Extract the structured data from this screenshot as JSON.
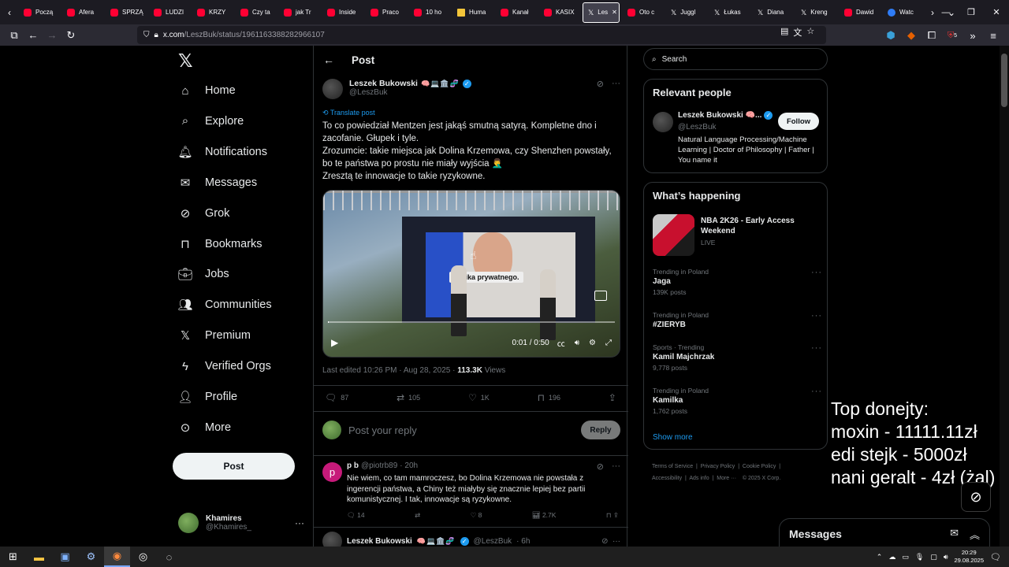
{
  "browser": {
    "tabs": [
      {
        "label": "Począ",
        "icon": "youtube-icon"
      },
      {
        "label": "Afera",
        "icon": "youtube-icon"
      },
      {
        "label": "SPRZĄ",
        "icon": "youtube-icon"
      },
      {
        "label": "LUDZI",
        "icon": "youtube-icon"
      },
      {
        "label": "KRZY",
        "icon": "youtube-icon"
      },
      {
        "label": "Czy ta",
        "icon": "youtube-icon"
      },
      {
        "label": "jak Tr",
        "icon": "youtube-icon"
      },
      {
        "label": "Inside",
        "icon": "youtube-icon"
      },
      {
        "label": "Praco",
        "icon": "youtube-icon"
      },
      {
        "label": "10 ho",
        "icon": "youtube-icon"
      },
      {
        "label": "Huma",
        "icon": "bookmark-icon"
      },
      {
        "label": "Kanał",
        "icon": "youtube-icon"
      },
      {
        "label": "KASIX",
        "icon": "youtube-icon"
      },
      {
        "label": "Les",
        "icon": "x-icon",
        "active": true
      },
      {
        "label": "Oto c",
        "icon": "youtube-icon"
      },
      {
        "label": "Juggl",
        "icon": "x-icon"
      },
      {
        "label": "Łukas",
        "icon": "x-icon"
      },
      {
        "label": "Diana",
        "icon": "x-icon"
      },
      {
        "label": "Kreng",
        "icon": "x-icon"
      },
      {
        "label": "Dawid",
        "icon": "youtube-icon"
      },
      {
        "label": "Watc",
        "icon": "copilot-icon"
      }
    ],
    "url_host": "x.com",
    "url_path": "/LeszBuk/status/1961163388282966107",
    "ext_badge": "5"
  },
  "nav": {
    "items": [
      {
        "label": "Home",
        "icon": "home-icon"
      },
      {
        "label": "Explore",
        "icon": "search-icon"
      },
      {
        "label": "Notifications",
        "icon": "bell-icon"
      },
      {
        "label": "Messages",
        "icon": "mail-icon"
      },
      {
        "label": "Grok",
        "icon": "grok-icon"
      },
      {
        "label": "Bookmarks",
        "icon": "bookmark-icon"
      },
      {
        "label": "Jobs",
        "icon": "briefcase-icon"
      },
      {
        "label": "Communities",
        "icon": "people-icon"
      },
      {
        "label": "Premium",
        "icon": "x-logo-icon"
      },
      {
        "label": "Verified Orgs",
        "icon": "lightning-icon"
      },
      {
        "label": "Profile",
        "icon": "person-icon"
      },
      {
        "label": "More",
        "icon": "more-circle-icon"
      }
    ],
    "post_button": "Post",
    "user": {
      "name": "Khamires",
      "handle": "@Khamires_"
    }
  },
  "main": {
    "header_title": "Post",
    "tweet": {
      "author": "Leszek Bukowski",
      "emoji": "🧠💻🏛️🧬",
      "handle": "@LeszBuk",
      "translate": "Translate post",
      "text_lines": [
        "To co powiedział Mentzen jest jakąś smutną satyrą. Kompletne dno i zacofanie. Głupek i tyle.",
        "Zrozumcie: takie miejsca jak Dolina Krzemowa, czy Shenzhen powstały, bo te państwa po prostu nie miały wyjścia 🤦‍♂️",
        "Zresztą te innowacje to takie ryzykowne."
      ],
      "video": {
        "caption": "yanika prywatnego.",
        "time": "0:01 / 0:50"
      },
      "meta_edited": "Last edited 10:26 PM · Aug 28, 2025 · ",
      "meta_views_count": "113.3K",
      "meta_views_label": " Views",
      "actions": {
        "replies": "87",
        "reposts": "105",
        "likes": "1K",
        "bookmarks": "196"
      }
    },
    "reply_placeholder": "Post your reply",
    "reply_button": "Reply",
    "reply": {
      "name": "p b",
      "avatar_letter": "p",
      "handle": "@piotrb89",
      "time": "· 20h",
      "text": "Nie wiem, co tam mamroczesz, bo Dolina Krzemowa nie powstała z ingerencji państwa, a Chiny też miałyby się znacznie lepiej bez partii komunistycznej. I tak, innowacje są ryzykowne.",
      "actions": {
        "replies": "14",
        "reposts": "",
        "likes": "8",
        "views": "2.7K"
      }
    },
    "next_reply": {
      "name": "Leszek Bukowski",
      "emoji": "🧠💻🏛️🧬",
      "handle": "@LeszBuk",
      "time": "· 6h"
    }
  },
  "sidebar": {
    "search_placeholder": "Search",
    "relevant_title": "Relevant people",
    "person": {
      "name": "Leszek Bukowski 🧠...",
      "handle": "@LeszBuk",
      "follow": "Follow",
      "bio": "Natural Language Processing/Machine Learning | Doctor of Philosophy | Father | You name it"
    },
    "happening_title": "What’s happening",
    "event": {
      "title": "NBA 2K26 - Early Access Weekend",
      "status": "LIVE"
    },
    "trends": [
      {
        "category": "Trending in Poland",
        "title": "Jaga",
        "count": "139K posts"
      },
      {
        "category": "Trending in Poland",
        "title": "#ZIERYB",
        "count": ""
      },
      {
        "category": "Sports · Trending",
        "title": "Kamil Majchrzak",
        "count": "9,778 posts"
      },
      {
        "category": "Trending in Poland",
        "title": "Kamilka",
        "count": "1,762 posts"
      }
    ],
    "show_more": "Show more",
    "footer": {
      "l1": "Terms of Service",
      "l2": "Privacy Policy",
      "l3": "Cookie Policy",
      "l4": "Accessibility",
      "l5": "Ads info",
      "l6": "More ···",
      "l7": "© 2025 X Corp."
    }
  },
  "overlay": {
    "line1": "Top donejty:",
    "line2": "moxin - 11111.11zł",
    "line3": "edi stejk - 5000zł",
    "line4": "nani geralt - 4zł (żal)"
  },
  "messages_drawer": "Messages",
  "taskbar": {
    "time": "20:29",
    "date": "29.08.2025"
  }
}
